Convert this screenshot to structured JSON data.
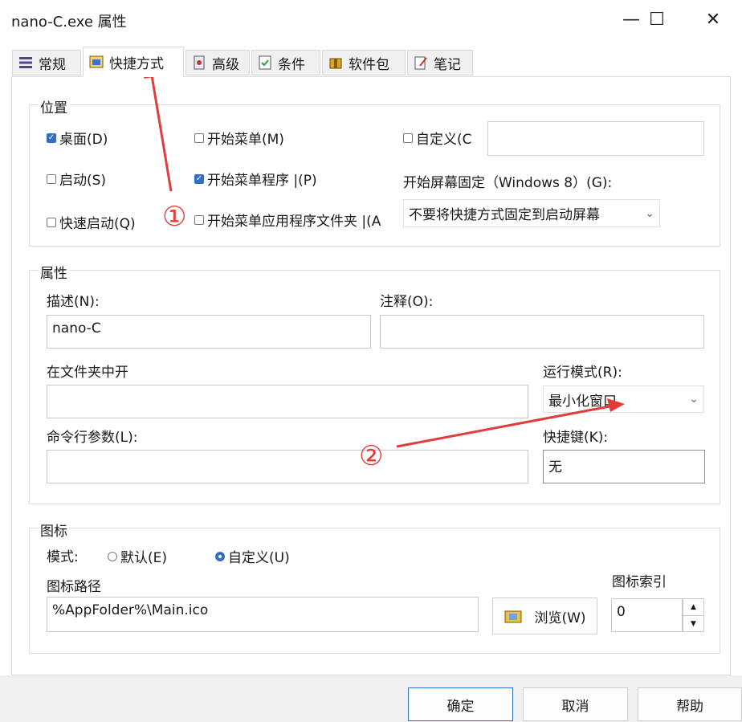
{
  "window": {
    "title": "nano-C.exe 属性",
    "min": "—",
    "max": "☐",
    "close": "✕"
  },
  "tabs": [
    {
      "label": "常规"
    },
    {
      "label": "快捷方式"
    },
    {
      "label": "高级"
    },
    {
      "label": "条件"
    },
    {
      "label": "软件包"
    },
    {
      "label": "笔记"
    }
  ],
  "location": {
    "legend": "位置",
    "desktop": "桌面(D)",
    "startup": "启动(S)",
    "quicklaunch": "快速启动(Q)",
    "startmenu": "开始菜单(M)",
    "startmenu_programs": "开始菜单程序 |(P)",
    "startmenu_apps": "开始菜单应用程序文件夹 |(A",
    "custom": "自定义(C",
    "pin_label": "开始屏幕固定（Windows 8）(G):",
    "pin_value": "不要将快捷方式固定到启动屏幕"
  },
  "props": {
    "legend": "属性",
    "desc_label": "描述(N):",
    "desc_value": "nano-C",
    "comment_label": "注释(O):",
    "comment_value": "",
    "folder_label": "在文件夹中开",
    "folder_value": "",
    "runmode_label": "运行模式(R):",
    "runmode_value": "最小化窗口",
    "args_label": "命令行参数(L):",
    "args_value": "",
    "hotkey_label": "快捷键(K):",
    "hotkey_value": "无"
  },
  "icon": {
    "legend": "图标",
    "mode_label": "模式:",
    "mode_default": "默认(E)",
    "mode_custom": "自定义(U)",
    "path_label": "图标路径",
    "path_value": "%AppFolder%\\Main.ico",
    "browse": "浏览(W)",
    "index_label": "图标索引",
    "index_value": "0"
  },
  "footer": {
    "ok": "确定",
    "cancel": "取消",
    "help": "帮助"
  },
  "annotations": {
    "one": "①",
    "two": "②"
  },
  "colors": {
    "accent": "#2f6fc4",
    "arrow": "#e23b3b"
  }
}
